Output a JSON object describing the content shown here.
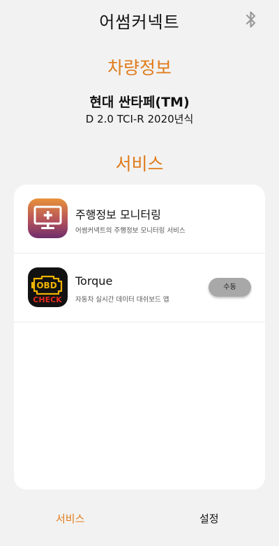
{
  "header": {
    "title": "어썸커넥트",
    "bluetooth_icon": "bluetooth-icon"
  },
  "vehicle": {
    "section_title": "차량정보",
    "name": "현대 싼타페(TM)",
    "engine": "D 2.0 TCI-R 2020년식"
  },
  "services": {
    "section_title": "서비스",
    "items": [
      {
        "name": "주행정보 모니터링",
        "description": "어썸커넥트의 주행정보 모니터링 서비스",
        "icon": "monitor-plus-icon"
      },
      {
        "name": "Torque",
        "description": "자동차 실시간 데이터 대쉬보드 앱",
        "icon": "obd-check-icon",
        "button_label": "수동"
      }
    ]
  },
  "nav": {
    "services_label": "서비스",
    "settings_label": "설정"
  },
  "colors": {
    "accent": "#e07b1a",
    "background": "#f2f2f2",
    "card": "#ffffff"
  }
}
